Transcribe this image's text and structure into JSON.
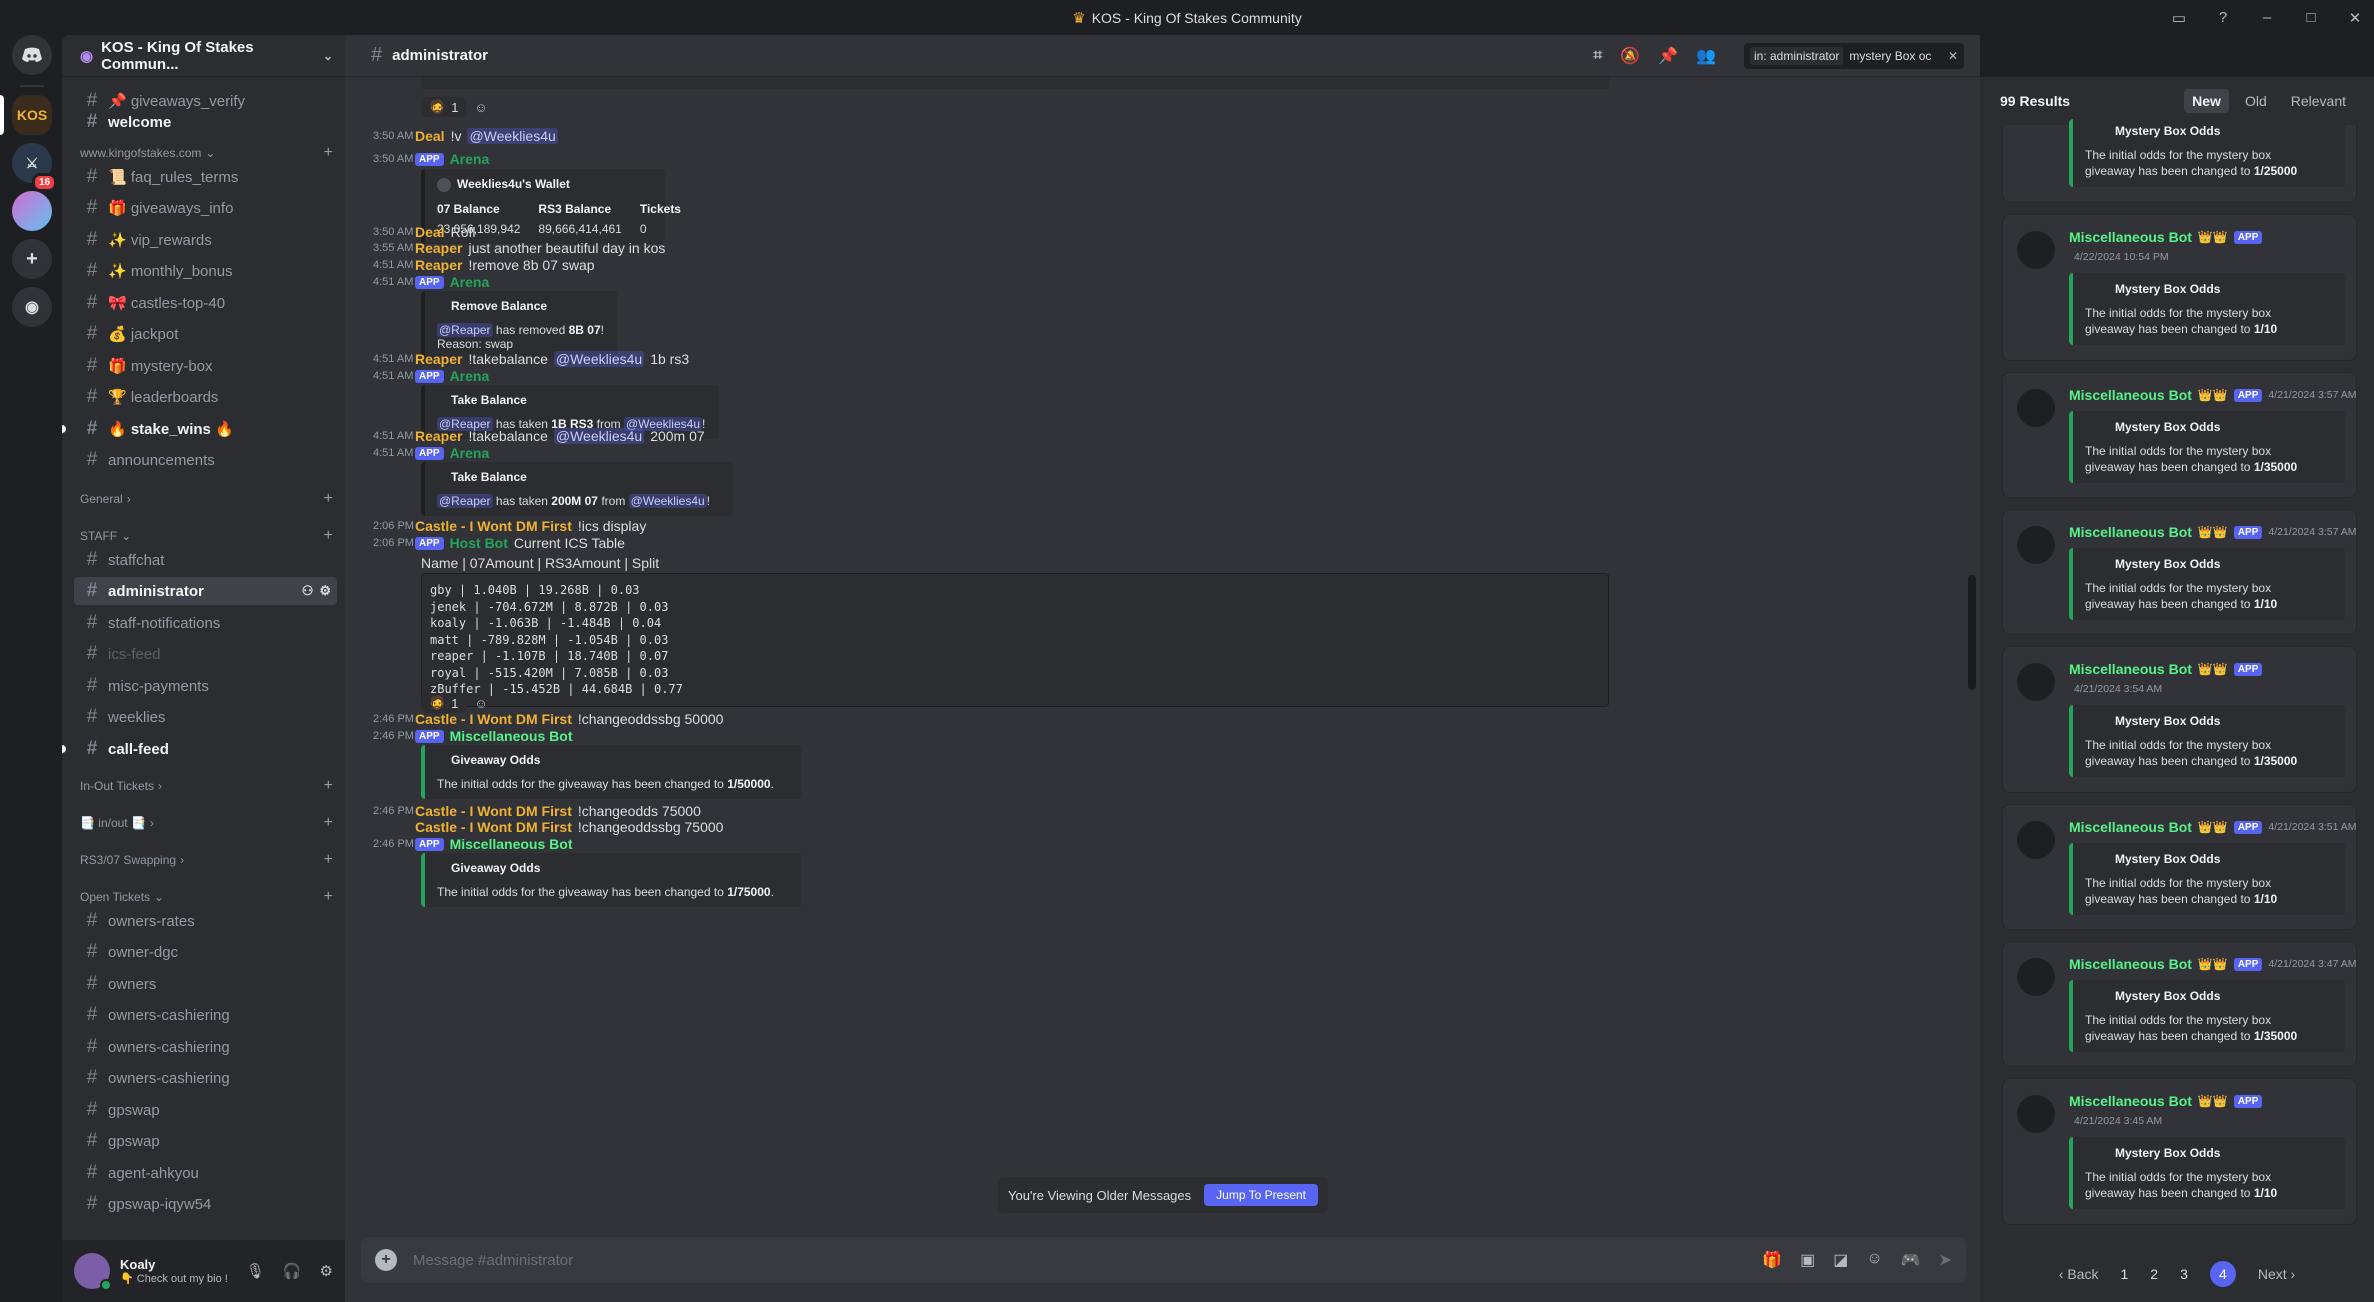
{
  "window": {
    "title": "KOS - King Of Stakes Community",
    "controls": [
      "inbox-icon",
      "help-icon",
      "minimize-icon",
      "maximize-icon",
      "close-icon"
    ]
  },
  "rail": {
    "discord_home": "discord-icon",
    "kos_label": "KOS",
    "badge_count": "16",
    "add_server": "+",
    "discover": "compass-icon"
  },
  "guild": {
    "name": "KOS - King Of Stakes Commun...",
    "categories": {
      "site": "www.kingofstakes.com",
      "general": "General",
      "staff": "STAFF",
      "inout": "In-Out Tickets",
      "rs3swap": "RS3/07 Swapping",
      "open": "Open Tickets"
    },
    "channels": {
      "giveaways_verify": "📌 giveaways_verify",
      "welcome": "welcome",
      "faq_rules_terms": "📜 faq_rules_terms",
      "giveaways_info": "🎁 giveaways_info",
      "vip_rewards": "✨ vip_rewards",
      "monthly_bonus": "✨ monthly_bonus",
      "castles_top_40": "🎀 castles-top-40",
      "jackpot": "💰 jackpot",
      "mystery_box": "🎁 mystery-box",
      "leaderboards": "🏆 leaderboards",
      "stake_wins": "🔥 stake_wins 🔥",
      "announcements": "announcements",
      "staffchat": "staffchat",
      "administrator": "administrator",
      "staff_notifications": "staff-notifications",
      "ics_feed": "ics-feed",
      "misc_payments": "misc-payments",
      "weeklies": "weeklies",
      "call_feed": "call-feed",
      "inout_chan": "📑 in/out 📑",
      "owners_rates": "owners-rates",
      "owner_dgc": "owner-dgc",
      "owners": "owners",
      "owners_cashiering_1": "owners-cashiering",
      "owners_cashiering_2": "owners-cashiering",
      "owners_cashiering_3": "owners-cashiering",
      "gpswap_1": "gpswap",
      "gpswap_2": "gpswap",
      "agent_ahkyou": "agent-ahkyou",
      "gpswap_iqyw54": "gpswap-iqyw54"
    }
  },
  "user": {
    "name": "Koaly",
    "status": "👇 Check out my bio !"
  },
  "chat": {
    "channel": "administrator",
    "search_scope": "in: administrator",
    "search_query": "mystery Box oc",
    "messages": [
      {
        "time": "3:50 AM",
        "user": "Deal",
        "text": "!v",
        "mention": "@Weeklies4u"
      },
      {
        "time": "3:50 AM",
        "app": "APP",
        "user": "Arena"
      },
      {
        "time": "3:50 AM",
        "user": "Deal",
        "text": "Rofl"
      },
      {
        "time": "3:55 AM",
        "user": "Reaper",
        "text": "just another beautiful day in kos"
      },
      {
        "time": "4:51 AM",
        "user": "Reaper",
        "text": "!remove 8b 07 swap"
      },
      {
        "time": "4:51 AM",
        "app": "APP",
        "user": "Arena"
      },
      {
        "time": "4:51 AM",
        "user": "Reaper",
        "text": "!takebalance",
        "mention": "@Weeklies4u",
        "after": "1b rs3"
      },
      {
        "time": "4:51 AM",
        "app": "APP",
        "user": "Arena"
      },
      {
        "time": "4:51 AM",
        "user": "Reaper",
        "text": "!takebalance",
        "mention": "@Weeklies4u",
        "after": "200m 07"
      },
      {
        "time": "4:51 AM",
        "app": "APP",
        "user": "Arena"
      },
      {
        "time": "2:06 PM",
        "user": "Castle - I Wont DM First",
        "text": "!ics display"
      },
      {
        "time": "2:06 PM",
        "app": "APP",
        "user": "Host Bot",
        "text": "Current ICS Table"
      },
      {
        "text": "Name | 07Amount | RS3Amount | Split"
      },
      {
        "time": "2:46 PM",
        "user": "Castle - I Wont DM First",
        "text": "!changeoddssbg 50000"
      },
      {
        "time": "2:46 PM",
        "app": "APP",
        "user": "Miscellaneous Bot"
      },
      {
        "time": "2:46 PM",
        "user": "Castle - I Wont DM First",
        "text": "!changeodds 75000"
      },
      {
        "user": "Castle - I Wont DM First",
        "text": "!changeoddssbg 75000"
      },
      {
        "time": "2:46 PM",
        "app": "APP",
        "user": "Miscellaneous Bot"
      }
    ],
    "wallet_embed": {
      "title": "Weeklies4u's Wallet",
      "cols": [
        {
          "h": "07 Balance",
          "v": "23,056,189,942"
        },
        {
          "h": "RS3 Balance",
          "v": "89,666,414,461"
        },
        {
          "h": "Tickets",
          "v": "0"
        }
      ]
    },
    "remove_embed": {
      "title": "Remove Balance",
      "mention": "@Reaper",
      "text1": "has removed",
      "amount": "8B 07",
      "bang": "!",
      "reason": "Reason: swap"
    },
    "take_embed_1": {
      "title": "Take Balance",
      "mention": "@Reaper",
      "text1": "has taken",
      "amount": "1B RS3",
      "from": "from",
      "target": "@Weeklies4u",
      "bang": "!"
    },
    "take_embed_2": {
      "title": "Take Balance",
      "mention": "@Reaper",
      "text1": "has taken",
      "amount": "200M 07",
      "from": "from",
      "target": "@Weeklies4u",
      "bang": "!"
    },
    "ics_table": [
      "gby | 1.040B | 19.268B | 0.03",
      "jenek | -704.672M | 8.872B | 0.03",
      "koaly | -1.063B | -1.484B | 0.04",
      "matt | -789.828M | -1.054B | 0.03",
      "reaper | -1.107B | 18.740B | 0.07",
      "royal | -515.420M | 7.085B | 0.03",
      "zBuffer | -15.452B | 44.684B | 0.77"
    ],
    "reaction_count": "1",
    "odds_embed_1": {
      "title": "Giveaway Odds",
      "text": "The initial odds for the giveaway has been changed to",
      "val": "1/50000",
      "dot": "."
    },
    "odds_embed_2": {
      "title": "Giveaway Odds",
      "text": "The initial odds for the giveaway has been changed to",
      "val": "1/75000",
      "dot": "."
    },
    "older_text": "You're Viewing Older Messages",
    "jump_label": "Jump To Present",
    "composer_placeholder": "Message #administrator"
  },
  "results": {
    "count": "99 Results",
    "sorts": [
      "New",
      "Old",
      "Relevant"
    ],
    "top_partial": {
      "title": "Mystery Box Odds",
      "line1": "The initial odds for the mystery box",
      "line2": "giveaway has been changed to",
      "val": "1/25000"
    },
    "cards": [
      {
        "bot": "Miscellaneous Bot",
        "crowns": "👑👑",
        "app": "APP",
        "date": "4/22/2024 10:54 PM",
        "title": "Mystery Box Odds",
        "line1": "The initial odds for the mystery box",
        "line2": "giveaway has been changed to",
        "val": "1/10"
      },
      {
        "bot": "Miscellaneous Bot",
        "crowns": "👑👑",
        "app": "APP",
        "date": "4/21/2024 3:57 AM",
        "title": "Mystery Box Odds",
        "line1": "The initial odds for the mystery box",
        "line2": "giveaway has been changed to",
        "val": "1/35000"
      },
      {
        "bot": "Miscellaneous Bot",
        "crowns": "👑👑",
        "app": "APP",
        "date": "4/21/2024 3:57 AM",
        "title": "Mystery Box Odds",
        "line1": "The initial odds for the mystery box",
        "line2": "giveaway has been changed to",
        "val": "1/10"
      },
      {
        "bot": "Miscellaneous Bot",
        "crowns": "👑👑",
        "app": "APP",
        "date": "4/21/2024 3:54 AM",
        "title": "Mystery Box Odds",
        "line1": "The initial odds for the mystery box",
        "line2": "giveaway has been changed to",
        "val": "1/35000"
      },
      {
        "bot": "Miscellaneous Bot",
        "crowns": "👑👑",
        "app": "APP",
        "date": "4/21/2024 3:51 AM",
        "title": "Mystery Box Odds",
        "line1": "The initial odds for the mystery box",
        "line2": "giveaway has been changed to",
        "val": "1/10"
      },
      {
        "bot": "Miscellaneous Bot",
        "crowns": "👑👑",
        "app": "APP",
        "date": "4/21/2024 3:47 AM",
        "title": "Mystery Box Odds",
        "line1": "The initial odds for the mystery box",
        "line2": "giveaway has been changed to",
        "val": "1/35000"
      },
      {
        "bot": "Miscellaneous Bot",
        "crowns": "👑👑",
        "app": "APP",
        "date": "4/21/2024 3:45 AM",
        "title": "Mystery Box Odds",
        "line1": "The initial odds for the mystery box",
        "line2": "giveaway has been changed to",
        "val": "1/10"
      }
    ],
    "pager": {
      "back": "‹ Back",
      "pages": [
        "1",
        "2",
        "3",
        "4"
      ],
      "next": "Next ›"
    }
  },
  "colors": {
    "accent": "#5865f2",
    "bot_green": "#57f287",
    "username_gold": "#f0b232",
    "bg_chat": "#313338"
  }
}
